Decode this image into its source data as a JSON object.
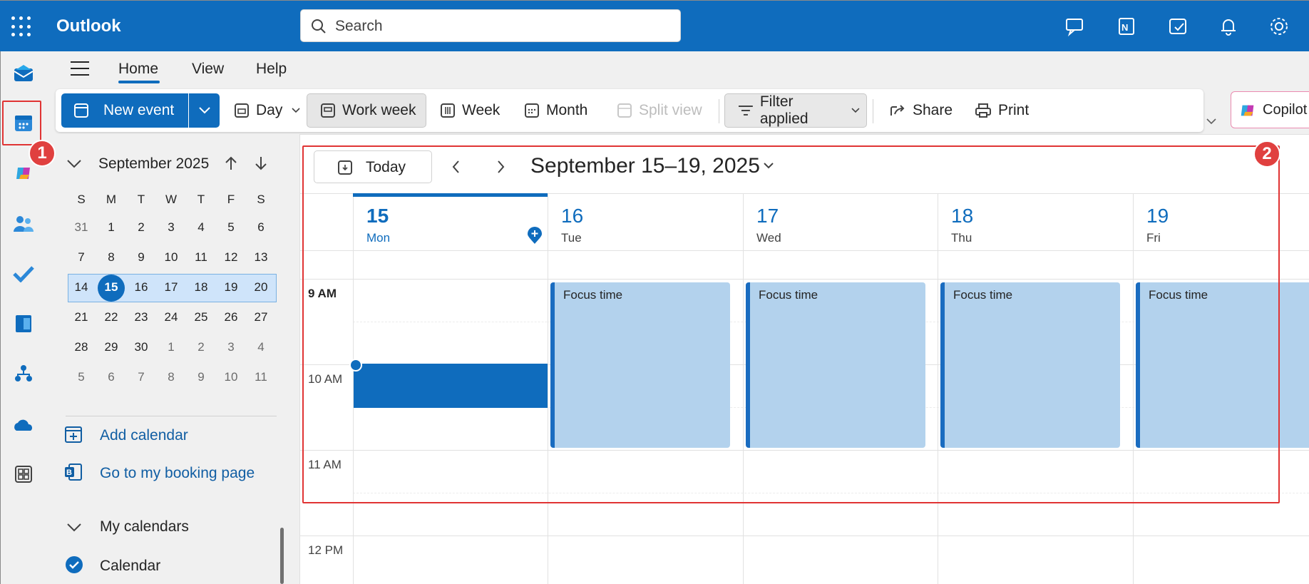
{
  "app": {
    "name": "Outlook"
  },
  "search": {
    "placeholder": "Search"
  },
  "menu": {
    "tabs": [
      "Home",
      "View",
      "Help"
    ]
  },
  "toolbar": {
    "new_event": "New event",
    "day": "Day",
    "work_week": "Work week",
    "week": "Week",
    "month": "Month",
    "split_view": "Split view",
    "filter": "Filter applied",
    "share": "Share",
    "print": "Print",
    "copilot": "Copilot"
  },
  "annotations": {
    "badge1": "1",
    "badge2": "2"
  },
  "mini_calendar": {
    "month_label": "September 2025",
    "weekdays": [
      "S",
      "M",
      "T",
      "W",
      "T",
      "F",
      "S"
    ],
    "weeks": [
      [
        "31",
        "1",
        "2",
        "3",
        "4",
        "5",
        "6"
      ],
      [
        "7",
        "8",
        "9",
        "10",
        "11",
        "12",
        "13"
      ],
      [
        "14",
        "15",
        "16",
        "17",
        "18",
        "19",
        "20"
      ],
      [
        "21",
        "22",
        "23",
        "24",
        "25",
        "26",
        "27"
      ],
      [
        "28",
        "29",
        "30",
        "1",
        "2",
        "3",
        "4"
      ],
      [
        "5",
        "6",
        "7",
        "8",
        "9",
        "10",
        "11"
      ]
    ],
    "today": "15"
  },
  "left_links": {
    "add_calendar": "Add calendar",
    "booking": "Go to my booking page"
  },
  "my_calendars": {
    "label": "My calendars",
    "calendar": "Calendar"
  },
  "calendar": {
    "today_btn": "Today",
    "range": "September 15–19, 2025",
    "days": [
      {
        "num": "15",
        "name": "Mon"
      },
      {
        "num": "16",
        "name": "Tue"
      },
      {
        "num": "17",
        "name": "Wed"
      },
      {
        "num": "18",
        "name": "Thu"
      },
      {
        "num": "19",
        "name": "Fri"
      }
    ],
    "times": [
      "9 AM",
      "10 AM",
      "11 AM",
      "12 PM"
    ],
    "event_title": "Focus time"
  },
  "colors": {
    "brand": "#0f6cbd",
    "event_bg": "#b3d2ed",
    "highlight": "#e03434"
  }
}
